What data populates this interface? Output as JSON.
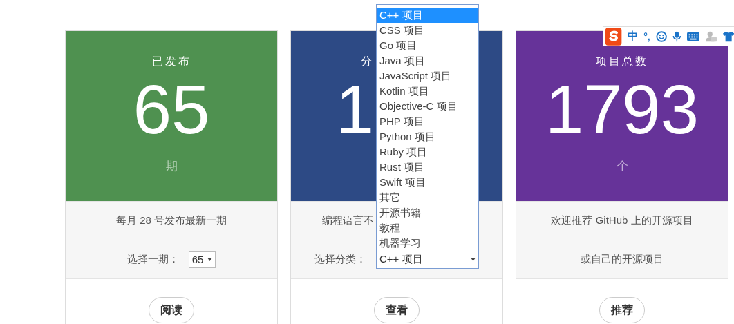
{
  "cards": [
    {
      "color": "#4f9150",
      "title": "已发布",
      "value": "65",
      "unit": "期",
      "rows": [
        {
          "kind": "text",
          "text": "每月 28 号发布最新一期"
        },
        {
          "kind": "select",
          "label": "选择一期：",
          "value": "65"
        }
      ],
      "button": "阅读"
    },
    {
      "color": "#2d4a85",
      "title": "分",
      "value": "1",
      "rows": [
        {
          "kind": "text",
          "text": "编程语言不"
        },
        {
          "kind": "select",
          "label": "选择分类：",
          "value": "C++ 项目",
          "dropdown": [
            {
              "label": "C++ 项目",
              "selected": true
            },
            {
              "label": "CSS 项目",
              "selected": false
            },
            {
              "label": "Go 项目",
              "selected": false
            },
            {
              "label": "Java 项目",
              "selected": false
            },
            {
              "label": "JavaScript 项目",
              "selected": false
            },
            {
              "label": "Kotlin 项目",
              "selected": false
            },
            {
              "label": "Objective-C 项目",
              "selected": false
            },
            {
              "label": "PHP 项目",
              "selected": false
            },
            {
              "label": "Python 项目",
              "selected": false
            },
            {
              "label": "Ruby 项目",
              "selected": false
            },
            {
              "label": "Rust 项目",
              "selected": false
            },
            {
              "label": "Swift 项目",
              "selected": false
            },
            {
              "label": "其它",
              "selected": false
            },
            {
              "label": "开源书籍",
              "selected": false
            },
            {
              "label": "教程",
              "selected": false
            },
            {
              "label": "机器学习",
              "selected": false
            }
          ]
        }
      ],
      "button": "查看"
    },
    {
      "color": "#663399",
      "title": "项目总数",
      "value": "1793",
      "unit": "个",
      "rows": [
        {
          "kind": "text",
          "text": "欢迎推荐 GitHub 上的开源项目"
        },
        {
          "kind": "text",
          "text": "或自己的开源项目"
        }
      ],
      "button": "推荐"
    }
  ],
  "ime_toolbar": {
    "mode": "中",
    "punctuation": "°,"
  }
}
